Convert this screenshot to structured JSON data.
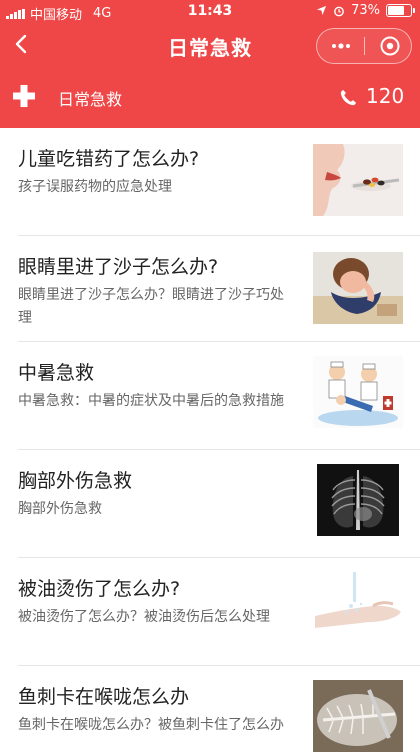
{
  "status_bar": {
    "carrier": "中国移动",
    "network": "4G",
    "time": "11:43",
    "battery_text": "73%",
    "battery_level": 0.73
  },
  "nav": {
    "back_icon": "chevron-left-icon",
    "title": "日常急救",
    "more_icon": "more-dots-icon",
    "close_icon": "target-circle-icon"
  },
  "header": {
    "plus_icon": "plus-icon",
    "title": "日常急救",
    "phone_icon": "phone-icon",
    "phone_number": "120"
  },
  "items": [
    {
      "title": "儿童吃错药了怎么办?",
      "desc": "孩子误服药物的应急处理"
    },
    {
      "title": "眼睛里进了沙子怎么办?",
      "desc": "眼睛里进了沙子怎么办？眼睛进了沙子巧处理"
    },
    {
      "title": "中暑急救",
      "desc": "中暑急救：中暑的症状及中暑后的急救措施"
    },
    {
      "title": "胸部外伤急救",
      "desc": "胸部外伤急救"
    },
    {
      "title": "被油烫伤了怎么办?",
      "desc": "被油烫伤了怎么办？被油烫伤后怎么处理"
    },
    {
      "title": "鱼刺卡在喉咙怎么办",
      "desc": "鱼刺卡在喉咙怎么办？被鱼刺卡住了怎么办"
    }
  ],
  "colors": {
    "accent": "#ef4747"
  }
}
